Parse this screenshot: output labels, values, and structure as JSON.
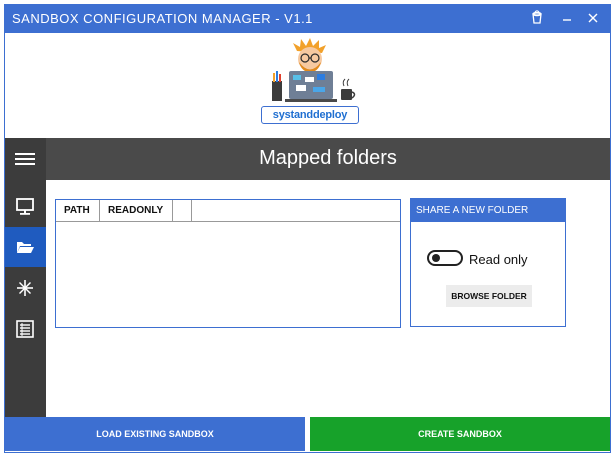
{
  "window": {
    "title": "SANDBOX CONFIGURATION MANAGER - V1.1",
    "controls": [
      "bucket-icon",
      "minimize-icon",
      "close-icon"
    ]
  },
  "logo": {
    "text": "systanddeploy"
  },
  "sidebar": {
    "items": [
      {
        "icon": "hamburger-menu-icon"
      },
      {
        "icon": "monitor-icon"
      },
      {
        "icon": "folder-open-icon",
        "active": true
      },
      {
        "icon": "sparkle-icon"
      },
      {
        "icon": "list-icon"
      }
    ]
  },
  "header": {
    "title": "Mapped folders"
  },
  "table": {
    "columns": [
      "PATH",
      "READONLY",
      "",
      ""
    ],
    "rows": []
  },
  "share": {
    "heading": "SHARE A NEW FOLDER",
    "toggle_label": "Read only",
    "toggle_on": false,
    "browse_label": "BROWSE FOLDER"
  },
  "footer": {
    "load_label": "LOAD EXISTING SANDBOX",
    "create_label": "CREATE SANDBOX"
  },
  "colors": {
    "accent": "#3d6fd1",
    "sidebar": "#3c3c3c",
    "header": "#4a4a4a",
    "create": "#17a22a"
  }
}
